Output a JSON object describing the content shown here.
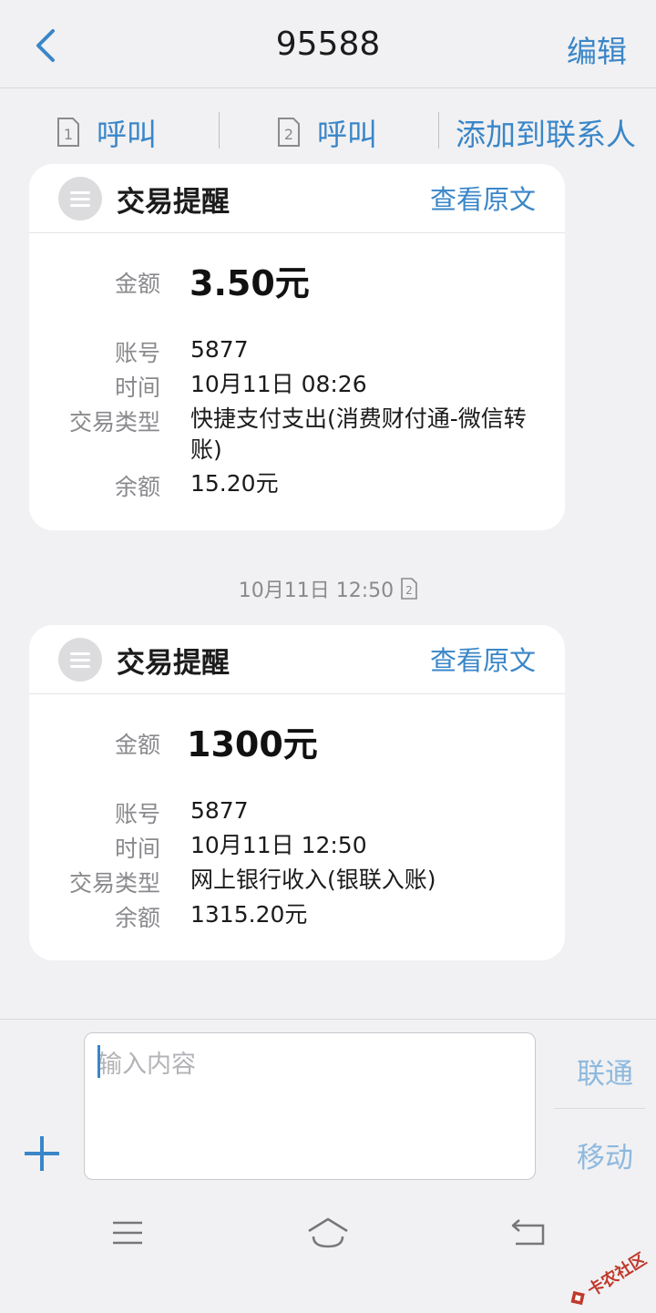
{
  "header": {
    "title": "95588",
    "edit_label": "编辑"
  },
  "callbar": {
    "call1_label": "呼叫",
    "call2_label": "呼叫",
    "sim1": "1",
    "sim2": "2",
    "add_contact_label": "添加到联系人"
  },
  "messages": [
    {
      "title": "交易提醒",
      "view_original": "查看原文",
      "amount_label": "金额",
      "amount": "3.50元",
      "rows": [
        {
          "label": "账号",
          "value": "5877"
        },
        {
          "label": "时间",
          "value": "10月11日 08:26"
        },
        {
          "label": "交易类型",
          "value": "快捷支付支出(消费财付通-微信转账)"
        },
        {
          "label": "余额",
          "value": "15.20元"
        }
      ]
    },
    {
      "timestamp": "10月11日 12:50",
      "sim": "2",
      "title": "交易提醒",
      "view_original": "查看原文",
      "amount_label": "金额",
      "amount": "1300元",
      "rows": [
        {
          "label": "账号",
          "value": "5877"
        },
        {
          "label": "时间",
          "value": "10月11日 12:50"
        },
        {
          "label": "交易类型",
          "value": "网上银行收入(银联入账)"
        },
        {
          "label": "余额",
          "value": "1315.20元"
        }
      ]
    }
  ],
  "composer": {
    "placeholder": "输入内容",
    "send_unicom": "联通",
    "send_mobile": "移动"
  },
  "watermark": "卡农社区",
  "colors": {
    "accent": "#3a86c8",
    "background": "#f1f1f3",
    "card": "#ffffff",
    "label": "#8a8a8e"
  }
}
